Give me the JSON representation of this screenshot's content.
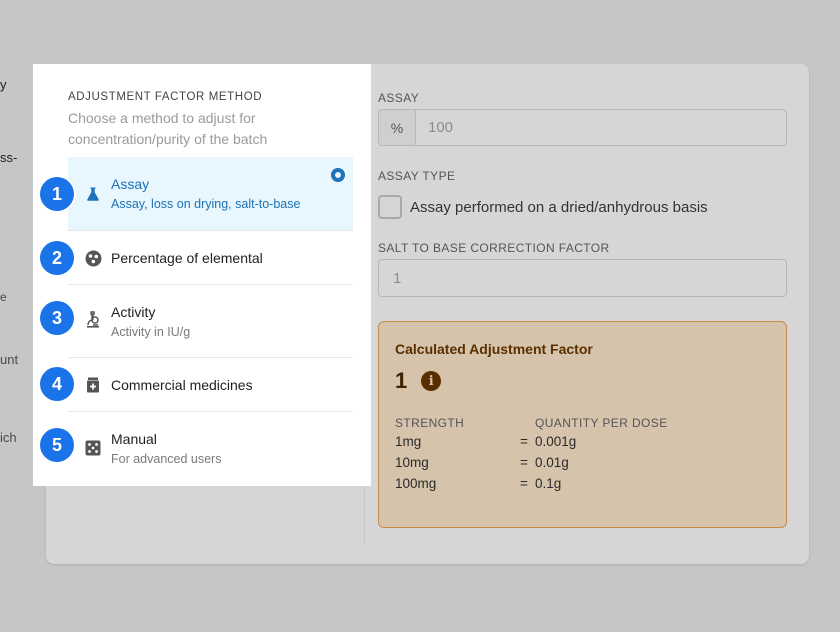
{
  "background_fragments": [
    "y",
    "ss-",
    "e",
    "unt",
    "ich"
  ],
  "popup": {
    "title": "ADJUSTMENT FACTOR METHOD",
    "subtitle": "Choose a method to adjust for concentration/purity of the batch",
    "options": [
      {
        "label": "Assay",
        "description": "Assay, loss on drying, salt-to-base",
        "icon": "flask-icon",
        "selected": true
      },
      {
        "label": "Percentage of elemental",
        "description": "",
        "icon": "molecule-icon",
        "selected": false
      },
      {
        "label": "Activity",
        "description": "Activity in IU/g",
        "icon": "microscope-icon",
        "selected": false
      },
      {
        "label": "Commercial medicines",
        "description": "",
        "icon": "medicine-icon",
        "selected": false
      },
      {
        "label": "Manual",
        "description": "For advanced users",
        "icon": "dice-icon",
        "selected": false
      }
    ]
  },
  "badges": [
    "1",
    "2",
    "3",
    "4",
    "5"
  ],
  "form": {
    "assay_label": "ASSAY",
    "assay_prefix": "%",
    "assay_placeholder": "100",
    "assay_type_label": "ASSAY TYPE",
    "assay_type_checkbox": "Assay performed on a dried/anhydrous basis",
    "assay_type_checked": false,
    "salt_label": "SALT TO BASE CORRECTION FACTOR",
    "salt_placeholder": "1"
  },
  "calculated": {
    "title": "Calculated Adjustment Factor",
    "value": "1",
    "info_icon": "info-icon",
    "col_strength": "STRENGTH",
    "col_quantity": "QUANTITY PER DOSE",
    "rows": [
      {
        "strength": "1mg",
        "eq": "=",
        "quantity": "0.001g"
      },
      {
        "strength": "10mg",
        "eq": "=",
        "quantity": "0.01g"
      },
      {
        "strength": "100mg",
        "eq": "=",
        "quantity": "0.1g"
      }
    ]
  },
  "colors": {
    "accent": "#1a73e8",
    "selected_bg": "#e8f6fd",
    "selected_text": "#1d72b8",
    "calc_border": "#c58b49"
  }
}
